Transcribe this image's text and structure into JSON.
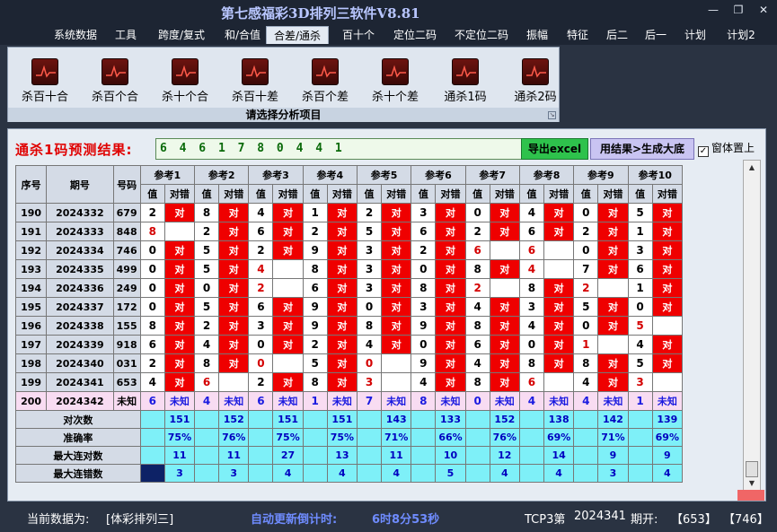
{
  "window": {
    "title": "第七感福彩3D排列三软件V8.81",
    "minimize": "—",
    "maximize": "❐",
    "close": "✕"
  },
  "menu": [
    "系统数据",
    "工具",
    "跨度/复式",
    "和/合值",
    "合差/通杀",
    "百十个",
    "定位二码",
    "不定位二码",
    "振幅",
    "特征",
    "后二",
    "后一",
    "计划",
    "计划2"
  ],
  "active_menu": "合差/通杀",
  "ribbon": {
    "items": [
      "杀百十合",
      "杀百个合",
      "杀十个合",
      "杀百十差",
      "杀百个差",
      "杀十个差",
      "通杀1码",
      "通杀2码"
    ],
    "caption": "请选择分析项目"
  },
  "prediction": {
    "label": "通杀1码预测结果:",
    "value": "6 4 6 1 7 8 0 4 4 1",
    "export": "导出excel",
    "generate": "用结果>生成大底",
    "topmost": "窗体置上"
  },
  "table": {
    "col_headers": {
      "index": "序号",
      "period": "期号",
      "number": "号码",
      "ref": [
        "参考1",
        "参考2",
        "参考3",
        "参考4",
        "参考5",
        "参考6",
        "参考7",
        "参考8",
        "参考9",
        "参考10"
      ],
      "sub_value": "值",
      "sub_result": "对错"
    },
    "rows": [
      {
        "i": "190",
        "p": "2024332",
        "n": "679",
        "v": [
          "2",
          "8",
          "4",
          "1",
          "2",
          "3",
          "0",
          "4",
          "0",
          "5"
        ],
        "r": [
          "对",
          "对",
          "对",
          "对",
          "对",
          "对",
          "对",
          "对",
          "对",
          "对"
        ]
      },
      {
        "i": "191",
        "p": "2024333",
        "n": "848",
        "v": [
          "8",
          "2",
          "6",
          "2",
          "5",
          "6",
          "2",
          "6",
          "2",
          "1"
        ],
        "r": [
          "",
          "对",
          "对",
          "对",
          "对",
          "对",
          "对",
          "对",
          "对",
          "对"
        ]
      },
      {
        "i": "192",
        "p": "2024334",
        "n": "746",
        "v": [
          "0",
          "5",
          "2",
          "9",
          "3",
          "2",
          "6",
          "6",
          "0",
          "3"
        ],
        "r": [
          "对",
          "对",
          "对",
          "对",
          "对",
          "对",
          "",
          "",
          "对",
          "对"
        ]
      },
      {
        "i": "193",
        "p": "2024335",
        "n": "499",
        "v": [
          "0",
          "5",
          "4",
          "8",
          "3",
          "0",
          "8",
          "4",
          "7",
          "6"
        ],
        "r": [
          "对",
          "对",
          "",
          "对",
          "对",
          "对",
          "对",
          "",
          "对",
          "对"
        ]
      },
      {
        "i": "194",
        "p": "2024336",
        "n": "249",
        "v": [
          "0",
          "0",
          "2",
          "6",
          "3",
          "8",
          "2",
          "8",
          "2",
          "1"
        ],
        "r": [
          "对",
          "对",
          "",
          "对",
          "对",
          "对",
          "",
          "对",
          "",
          "对"
        ]
      },
      {
        "i": "195",
        "p": "2024337",
        "n": "172",
        "v": [
          "0",
          "5",
          "6",
          "9",
          "0",
          "3",
          "4",
          "3",
          "5",
          "0"
        ],
        "r": [
          "对",
          "对",
          "对",
          "对",
          "对",
          "对",
          "对",
          "对",
          "对",
          "对"
        ]
      },
      {
        "i": "196",
        "p": "2024338",
        "n": "155",
        "v": [
          "8",
          "2",
          "3",
          "9",
          "8",
          "9",
          "8",
          "4",
          "0",
          "5"
        ],
        "r": [
          "对",
          "对",
          "对",
          "对",
          "对",
          "对",
          "对",
          "对",
          "对",
          ""
        ]
      },
      {
        "i": "197",
        "p": "2024339",
        "n": "918",
        "v": [
          "6",
          "4",
          "0",
          "2",
          "4",
          "0",
          "6",
          "0",
          "1",
          "4"
        ],
        "r": [
          "对",
          "对",
          "对",
          "对",
          "对",
          "对",
          "对",
          "对",
          "",
          "对"
        ]
      },
      {
        "i": "198",
        "p": "2024340",
        "n": "031",
        "v": [
          "2",
          "8",
          "0",
          "5",
          "0",
          "9",
          "4",
          "8",
          "8",
          "5"
        ],
        "r": [
          "对",
          "对",
          "",
          "对",
          "",
          "对",
          "对",
          "对",
          "对",
          "对"
        ]
      },
      {
        "i": "199",
        "p": "2024341",
        "n": "653",
        "v": [
          "4",
          "6",
          "2",
          "8",
          "3",
          "4",
          "8",
          "6",
          "4",
          "3"
        ],
        "r": [
          "对",
          "",
          "对",
          "对",
          "",
          "对",
          "对",
          "",
          "对",
          ""
        ]
      },
      {
        "i": "200",
        "p": "2024342",
        "n": "未知",
        "v": [
          "6",
          "4",
          "6",
          "1",
          "7",
          "8",
          "0",
          "4",
          "4",
          "1"
        ],
        "r": [
          "未知",
          "未知",
          "未知",
          "未知",
          "未知",
          "未知",
          "未知",
          "未知",
          "未知",
          "未知"
        ]
      }
    ],
    "red_values": [
      [
        1,
        0
      ],
      [
        2,
        6
      ],
      [
        4,
        6
      ],
      [
        3,
        2
      ],
      [
        4,
        2
      ],
      [
        6,
        2
      ],
      [
        7,
        8
      ],
      [
        9,
        8
      ],
      [
        4,
        6
      ],
      [
        3,
        7
      ],
      [
        4,
        6
      ],
      [
        9,
        5
      ],
      [
        7,
        8
      ],
      [
        2,
        4
      ],
      [
        9,
        8
      ]
    ],
    "stats": [
      {
        "label": "对次数",
        "values": [
          "151",
          "152",
          "151",
          "151",
          "143",
          "133",
          "152",
          "138",
          "142",
          "139"
        ]
      },
      {
        "label": "准确率",
        "values": [
          "75%",
          "76%",
          "75%",
          "75%",
          "71%",
          "66%",
          "76%",
          "69%",
          "71%",
          "69%"
        ]
      },
      {
        "label": "最大连对数",
        "values": [
          "11",
          "11",
          "27",
          "13",
          "11",
          "10",
          "12",
          "14",
          "9",
          "9"
        ]
      },
      {
        "label": "最大连错数",
        "values": [
          "3",
          "3",
          "4",
          "4",
          "4",
          "5",
          "4",
          "4",
          "3",
          "4"
        ]
      }
    ]
  },
  "status": {
    "current_label": "当前数据为:",
    "current_value": "[体彩排列三]",
    "countdown_label": "自动更新倒计时:",
    "countdown_value": "6时8分53秒",
    "draw_label": "TCP3第",
    "draw_period": "2024341",
    "open_label": "期开:",
    "open_value": "【653】",
    "next": "【746】"
  }
}
